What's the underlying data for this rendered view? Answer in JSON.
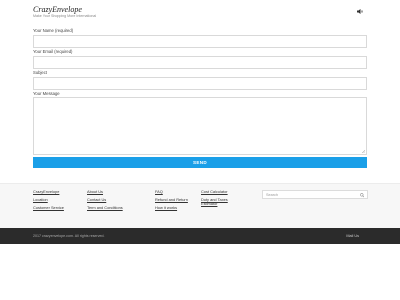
{
  "header": {
    "brand": "CrazyEnvelope",
    "tagline": "Make Your Shopping More International",
    "mute_icon": "speaker-mute-icon"
  },
  "form": {
    "name_label": "Your Name (required)",
    "email_label": "Your Email (required)",
    "subject_label": "Subject",
    "message_label": "Your Message",
    "name_value": "",
    "email_value": "",
    "subject_value": "",
    "message_value": "",
    "send_label": "SEND",
    "send_color": "#1a9fe8"
  },
  "footer": {
    "col1": [
      "CrazyEnvelope",
      "Location",
      "Customer Service"
    ],
    "col2": [
      "About Us",
      "Contact Us",
      "Term and Conditions"
    ],
    "col3": [
      "FAQ",
      "Refund and Return",
      "How it works"
    ],
    "col4": [
      "Cost Calculator",
      "Duty and Taxes Estimator"
    ],
    "search_placeholder": "Search",
    "search_icon": "search-icon"
  },
  "bottom_bar": {
    "copyright": "2017 crazyenvelope.com. All rights reserved.",
    "mail_us": "Mail Us",
    "background": "#2b2b2b"
  }
}
